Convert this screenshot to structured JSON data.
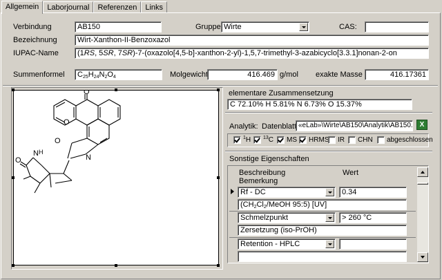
{
  "tabs": [
    "Allgemein",
    "Laborjournal",
    "Referenzen",
    "Links"
  ],
  "general": {
    "verbindung_label": "Verbindung",
    "verbindung_value": "AB150",
    "gruppe_label": "Gruppe",
    "gruppe_value": "Wirte",
    "cas_label": "CAS:",
    "cas_value": "",
    "bezeichnung_label": "Bezeichnung",
    "bezeichnung_value": "Wirt-Xanthon-II-Benzoxazol",
    "iupac_label": "IUPAC-Name",
    "iupac_parts": [
      "(1",
      "RS",
      ", 5",
      "SR",
      ", 7",
      "SR",
      ")-7-(oxazolo[4,5-b]-xanthon-2-yl)-1,5,7-trimethyl-3-azabicyclo[3.3.1]nonan-2-on"
    ],
    "summenformel_label": "Summenformel",
    "formula": {
      "c": "C",
      "c_n": "25",
      "h": "H",
      "h_n": "24",
      "n": "N",
      "n_n": "2",
      "o": "O",
      "o_n": "4"
    },
    "molgewicht_label": "Molgewicht",
    "molgewicht_value": "416.469",
    "molgewicht_unit": "g/mol",
    "exakte_masse_label": "exakte Masse",
    "exakte_masse_value": "416.17361"
  },
  "structure": {
    "atom_o1": "O",
    "atom_o2": "O",
    "atom_o3": "O",
    "atom_n1": "N",
    "atom_o4": "O",
    "atom_nh": "N",
    "atom_h": "H"
  },
  "composition": {
    "label": "elementare Zusammensetzung",
    "value": "C 72.10%  H 5.81%  N 6.73%  O 15.37%"
  },
  "analytik": {
    "label": "Analytik:",
    "datenblatt_label": "Datenblatt",
    "datenblatt_value": "«eLab»\\Wirte\\AB150\\Analytik\\AB150.xls",
    "excel_icon_letter": "X",
    "checks": {
      "h1": {
        "sup": "1",
        "text": "H",
        "checked": true
      },
      "c13": {
        "sup": "13",
        "text": "C",
        "checked": true
      },
      "ms": {
        "text": "MS",
        "checked": true
      },
      "hrms": {
        "text": "HRMS",
        "checked": true
      },
      "ir": {
        "text": "IR",
        "checked": false
      },
      "chn": {
        "text": "CHN",
        "checked": false
      },
      "abgeschlossen": {
        "text": "abgeschlossen",
        "checked": false
      }
    }
  },
  "properties": {
    "label": "Sonstige Eigenschaften",
    "col_beschreibung": "Beschreibung",
    "col_bemerkung": "Bemerkung",
    "col_wert": "Wert",
    "rows": [
      {
        "name": "Rf - DC",
        "value": "0.34",
        "remark_parts": [
          "(CH",
          "2",
          "Cl",
          "2",
          "/MeOH 95:5) [UV]"
        ]
      },
      {
        "name": "Schmelzpunkt",
        "value": "> 260 °C",
        "remark": "Zersetzung (iso-PrOH)"
      },
      {
        "name": "Retention - HPLC",
        "value": "",
        "remark": ""
      }
    ]
  }
}
